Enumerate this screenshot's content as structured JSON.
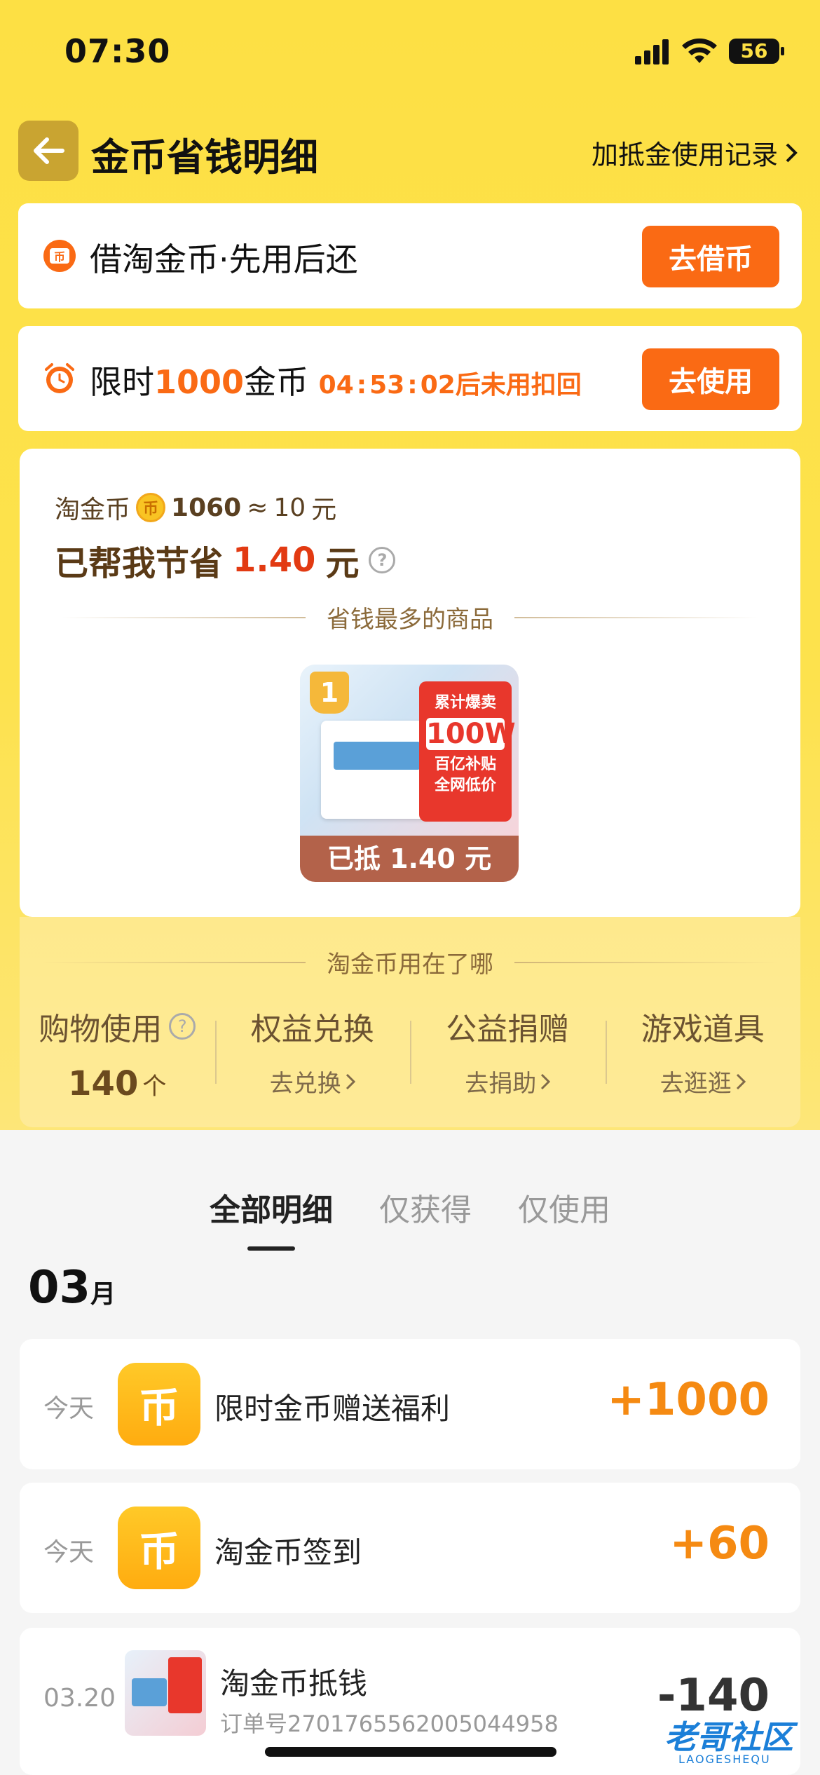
{
  "status": {
    "time": "07:30",
    "battery": "56"
  },
  "header": {
    "title": "金币省钱明细",
    "record_link": "加抵金使用记录"
  },
  "banner_borrow": {
    "text": "借淘金币·先用后还",
    "action": "去借币"
  },
  "banner_limited": {
    "prefix": "限时",
    "amount": "1000",
    "suffix": "金币",
    "countdown_h": "04",
    "countdown_m": "53",
    "countdown_s": "02",
    "tail": "后未用扣回",
    "action": "去使用"
  },
  "savings": {
    "coin_label": "淘金币",
    "coin_count": "1060",
    "approx": "≈",
    "yuan_value": "10",
    "yuan": "元",
    "saved_prefix": "已帮我节省",
    "saved_amount": "1.40",
    "saved_unit": "元",
    "top_products_title": "省钱最多的商品",
    "product": {
      "rank": "1",
      "panel_line1": "累计爆卖",
      "panel_big": "100W",
      "panel_line2": "百亿补贴",
      "panel_line3": "全网低价",
      "deducted": "已抵 1.40 元"
    }
  },
  "usage": {
    "title": "淘金币用在了哪",
    "columns": [
      {
        "name": "购物使用",
        "value": "140",
        "unit": "个"
      },
      {
        "name": "权益兑换",
        "sub": "去兑换"
      },
      {
        "name": "公益捐赠",
        "sub": "去捐助"
      },
      {
        "name": "游戏道具",
        "sub": "去逛逛"
      }
    ]
  },
  "tabs": [
    "全部明细",
    "仅获得",
    "仅使用"
  ],
  "month": {
    "num": "03",
    "unit": "月"
  },
  "transactions": [
    {
      "date": "今天",
      "icon": "币",
      "title": "限时金币赠送福利",
      "amount": "+1000"
    },
    {
      "date": "今天",
      "icon": "币",
      "title": "淘金币签到",
      "amount": "+60"
    },
    {
      "date": "03.20",
      "title": "淘金币抵钱",
      "order": "订单号2701765562005044958",
      "amount": "-140"
    }
  ],
  "watermark": {
    "text": "老哥社区",
    "sub": "LAOGESHEQU"
  }
}
